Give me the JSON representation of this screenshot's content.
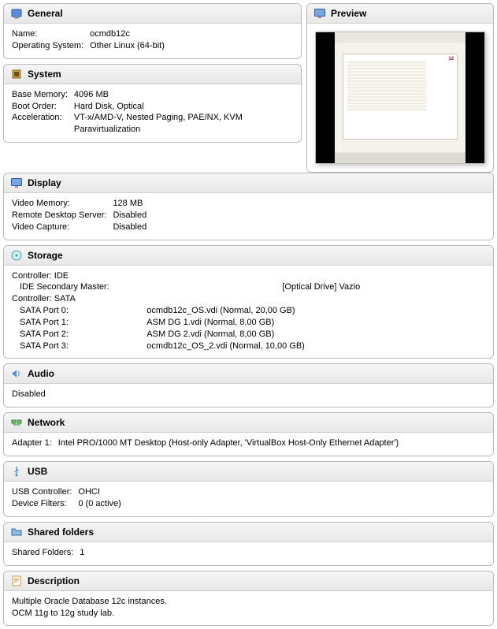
{
  "general": {
    "title": "General",
    "name_label": "Name:",
    "name_value": "ocmdb12c",
    "os_label": "Operating System:",
    "os_value": "Other Linux (64-bit)"
  },
  "system": {
    "title": "System",
    "mem_label": "Base Memory:",
    "mem_value": "4096 MB",
    "boot_label": "Boot Order:",
    "boot_value": "Hard Disk, Optical",
    "accel_label": "Acceleration:",
    "accel_value1": "VT-x/AMD-V, Nested Paging, PAE/NX, KVM",
    "accel_value2": "Paravirtualization"
  },
  "preview": {
    "title": "Preview",
    "badge": "12"
  },
  "display": {
    "title": "Display",
    "vmem_label": "Video Memory:",
    "vmem_value": "128 MB",
    "rds_label": "Remote Desktop Server:",
    "rds_value": "Disabled",
    "vcap_label": "Video Capture:",
    "vcap_value": "Disabled"
  },
  "storage": {
    "title": "Storage",
    "ctrl_ide": "Controller: IDE",
    "ide_sm_label": "IDE Secondary Master:",
    "ide_sm_value": "[Optical Drive] Vazio",
    "ctrl_sata": "Controller: SATA",
    "sata0_label": "SATA Port 0:",
    "sata0_value": "ocmdb12c_OS.vdi (Normal, 20,00 GB)",
    "sata1_label": "SATA Port 1:",
    "sata1_value": "ASM DG 1.vdi (Normal, 8,00 GB)",
    "sata2_label": "SATA Port 2:",
    "sata2_value": "ASM DG 2.vdi (Normal, 8,00 GB)",
    "sata3_label": "SATA Port 3:",
    "sata3_value": "ocmdb12c_OS_2.vdi (Normal, 10,00 GB)"
  },
  "audio": {
    "title": "Audio",
    "status": "Disabled"
  },
  "network": {
    "title": "Network",
    "adapter_label": "Adapter 1:",
    "adapter_value": "Intel PRO/1000 MT Desktop (Host-only Adapter, 'VirtualBox Host-Only Ethernet Adapter')"
  },
  "usb": {
    "title": "USB",
    "ctrl_label": "USB Controller:",
    "ctrl_value": "OHCI",
    "filters_label": "Device Filters:",
    "filters_value": "0 (0 active)"
  },
  "shared": {
    "title": "Shared folders",
    "label": "Shared Folders:",
    "value": "1"
  },
  "description": {
    "title": "Description",
    "line1": "Multiple Oracle Database 12c instances.",
    "line2": "OCM 11g to 12g study lab."
  }
}
